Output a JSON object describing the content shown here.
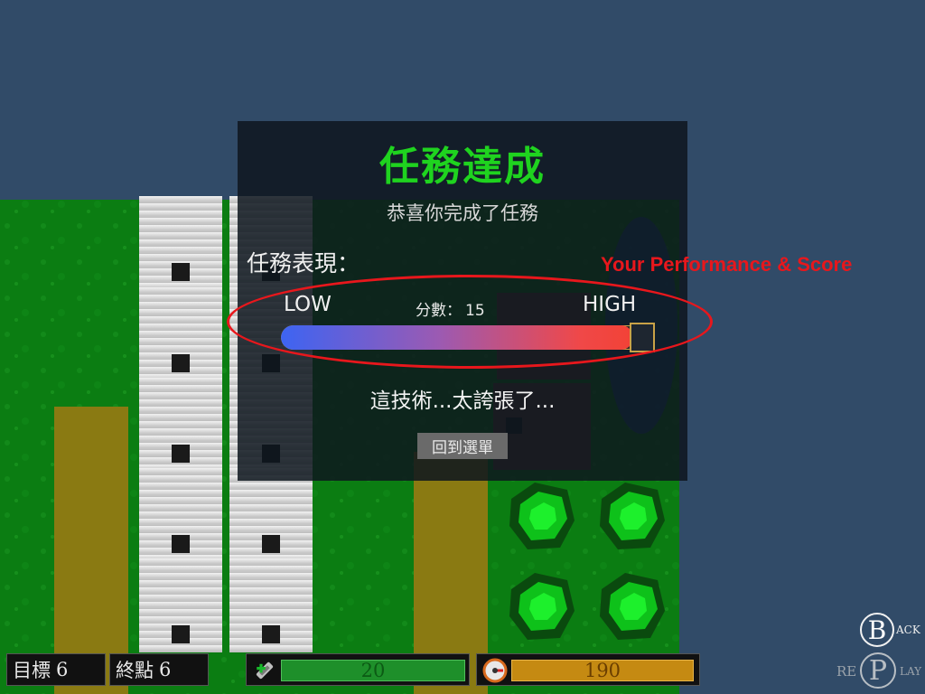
{
  "modal": {
    "title": "任務達成",
    "subtitle": "恭喜你完成了任務",
    "performance_label": "任務表現：",
    "low_label": "LOW",
    "high_label": "HIGH",
    "score_label": "分數：",
    "score_value": "15",
    "performance_fraction": 0.97,
    "comment": "這技術...太誇張了...",
    "menu_button": "回到選單"
  },
  "annotation": {
    "text": "Your Performance & Score",
    "color": "#e8171c"
  },
  "hud": {
    "target_label": "目標",
    "target_value": "6",
    "endpoint_label": "終點",
    "endpoint_value": "6",
    "resource1_icon": "wrench-icon",
    "resource1_value": "20",
    "resource1_color": "#1e8f2a",
    "resource2_icon": "gauge-icon",
    "resource2_value": "190",
    "resource2_color": "#c58a12"
  },
  "controls": {
    "back_letter": "B",
    "back_rest": "ACK",
    "replay_left": "RE",
    "replay_letter": "P",
    "replay_right": "LAY"
  },
  "colors": {
    "sky": "#314b68",
    "grass": "#0b7d12",
    "path": "#8a7a12",
    "title_green": "#1fd31f"
  }
}
